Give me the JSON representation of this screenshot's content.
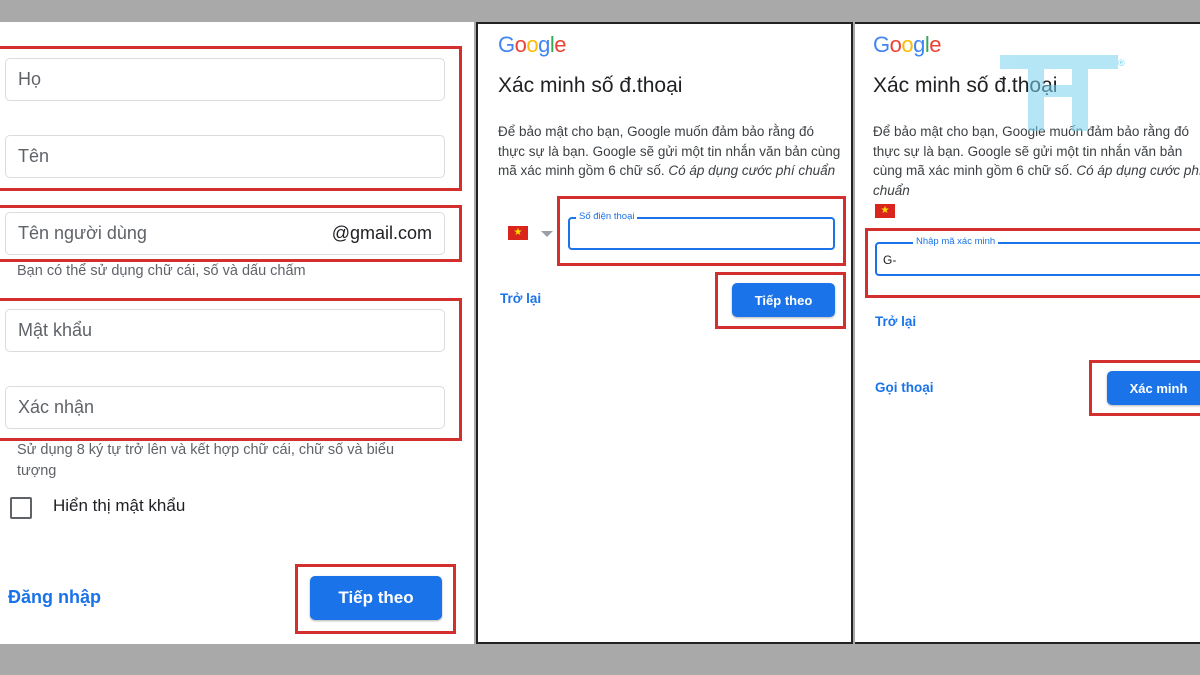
{
  "colors": {
    "background": "#a9a9a9",
    "accent": "#1a73e8",
    "highlight": "#d32f2f",
    "flag_red": "#da251d",
    "flag_star": "#ffde00"
  },
  "panel1": {
    "last_name_placeholder": "Họ",
    "first_name_placeholder": "Tên",
    "username_placeholder": "Tên người dùng",
    "username_suffix": "@gmail.com",
    "username_hint": "Bạn có thể sử dụng chữ cái, số và dấu chấm",
    "password_placeholder": "Mật khẩu",
    "confirm_placeholder": "Xác nhận",
    "password_hint": "Sử dụng 8 ký tự trở lên và kết hợp chữ cái, chữ số và biểu tượng",
    "show_password_label": "Hiển thị mật khẩu",
    "signin_link": "Đăng nhập",
    "next_button": "Tiếp theo"
  },
  "panel2": {
    "logo_letters": [
      "G",
      "o",
      "o",
      "g",
      "l",
      "e"
    ],
    "title": "Xác minh số đ.thoại",
    "description": "Để bảo mật cho bạn, Google muốn đảm bảo rằng đó thực sự là bạn. Google sẽ gửi một tin nhắn văn bản cùng mã xác minh gồm 6 chữ số. ",
    "description_italic": "Có áp dụng cước phí chuẩn",
    "flag_icon": "vietnam-flag-icon",
    "phone_label": "Số điện thoại",
    "phone_value": "",
    "back_link": "Trở lại",
    "next_button": "Tiếp theo"
  },
  "panel3": {
    "logo_letters": [
      "G",
      "o",
      "o",
      "g",
      "l",
      "e"
    ],
    "title": "Xác minh số đ.thoại",
    "description": "Để bảo mật cho bạn, Google muốn đảm bảo rằng đó thực sự là bạn. Google sẽ gửi một tin nhắn văn bản cùng mã xác minh gồm 6 chữ số. ",
    "description_italic": "Có áp dụng cước phí chuẩn",
    "flag_icon": "vietnam-flag-icon",
    "code_label": "Nhập mã xác minh",
    "code_value": "G-",
    "back_link": "Trở lại",
    "call_link": "Gọi thoại",
    "verify_button": "Xác minh"
  },
  "logo_colors": [
    "#4285F4",
    "#EA4335",
    "#FBBC05",
    "#4285F4",
    "#34A853",
    "#EA4335"
  ]
}
